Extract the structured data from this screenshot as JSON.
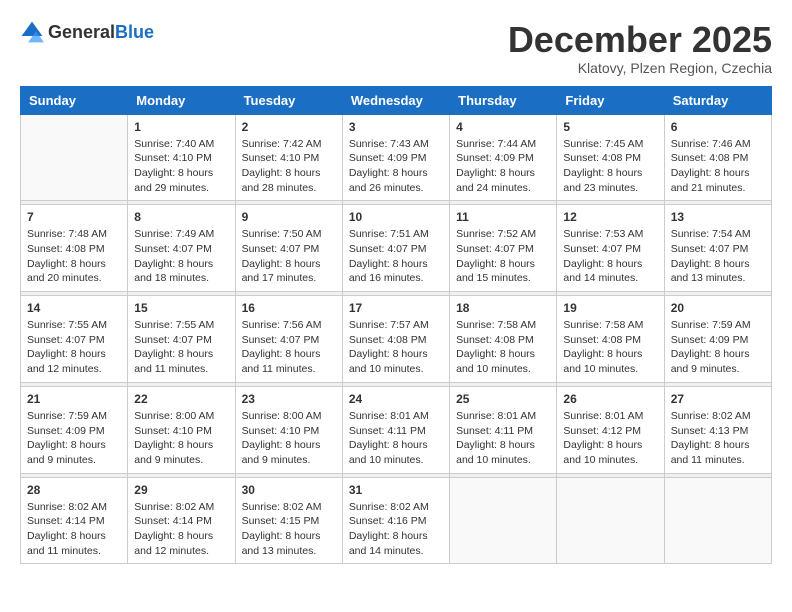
{
  "logo": {
    "general": "General",
    "blue": "Blue"
  },
  "title": "December 2025",
  "location": "Klatovy, Plzen Region, Czechia",
  "headers": [
    "Sunday",
    "Monday",
    "Tuesday",
    "Wednesday",
    "Thursday",
    "Friday",
    "Saturday"
  ],
  "weeks": [
    [
      {
        "day": "",
        "info": ""
      },
      {
        "day": "1",
        "info": "Sunrise: 7:40 AM\nSunset: 4:10 PM\nDaylight: 8 hours\nand 29 minutes."
      },
      {
        "day": "2",
        "info": "Sunrise: 7:42 AM\nSunset: 4:10 PM\nDaylight: 8 hours\nand 28 minutes."
      },
      {
        "day": "3",
        "info": "Sunrise: 7:43 AM\nSunset: 4:09 PM\nDaylight: 8 hours\nand 26 minutes."
      },
      {
        "day": "4",
        "info": "Sunrise: 7:44 AM\nSunset: 4:09 PM\nDaylight: 8 hours\nand 24 minutes."
      },
      {
        "day": "5",
        "info": "Sunrise: 7:45 AM\nSunset: 4:08 PM\nDaylight: 8 hours\nand 23 minutes."
      },
      {
        "day": "6",
        "info": "Sunrise: 7:46 AM\nSunset: 4:08 PM\nDaylight: 8 hours\nand 21 minutes."
      }
    ],
    [
      {
        "day": "7",
        "info": "Sunrise: 7:48 AM\nSunset: 4:08 PM\nDaylight: 8 hours\nand 20 minutes."
      },
      {
        "day": "8",
        "info": "Sunrise: 7:49 AM\nSunset: 4:07 PM\nDaylight: 8 hours\nand 18 minutes."
      },
      {
        "day": "9",
        "info": "Sunrise: 7:50 AM\nSunset: 4:07 PM\nDaylight: 8 hours\nand 17 minutes."
      },
      {
        "day": "10",
        "info": "Sunrise: 7:51 AM\nSunset: 4:07 PM\nDaylight: 8 hours\nand 16 minutes."
      },
      {
        "day": "11",
        "info": "Sunrise: 7:52 AM\nSunset: 4:07 PM\nDaylight: 8 hours\nand 15 minutes."
      },
      {
        "day": "12",
        "info": "Sunrise: 7:53 AM\nSunset: 4:07 PM\nDaylight: 8 hours\nand 14 minutes."
      },
      {
        "day": "13",
        "info": "Sunrise: 7:54 AM\nSunset: 4:07 PM\nDaylight: 8 hours\nand 13 minutes."
      }
    ],
    [
      {
        "day": "14",
        "info": "Sunrise: 7:55 AM\nSunset: 4:07 PM\nDaylight: 8 hours\nand 12 minutes."
      },
      {
        "day": "15",
        "info": "Sunrise: 7:55 AM\nSunset: 4:07 PM\nDaylight: 8 hours\nand 11 minutes."
      },
      {
        "day": "16",
        "info": "Sunrise: 7:56 AM\nSunset: 4:07 PM\nDaylight: 8 hours\nand 11 minutes."
      },
      {
        "day": "17",
        "info": "Sunrise: 7:57 AM\nSunset: 4:08 PM\nDaylight: 8 hours\nand 10 minutes."
      },
      {
        "day": "18",
        "info": "Sunrise: 7:58 AM\nSunset: 4:08 PM\nDaylight: 8 hours\nand 10 minutes."
      },
      {
        "day": "19",
        "info": "Sunrise: 7:58 AM\nSunset: 4:08 PM\nDaylight: 8 hours\nand 10 minutes."
      },
      {
        "day": "20",
        "info": "Sunrise: 7:59 AM\nSunset: 4:09 PM\nDaylight: 8 hours\nand 9 minutes."
      }
    ],
    [
      {
        "day": "21",
        "info": "Sunrise: 7:59 AM\nSunset: 4:09 PM\nDaylight: 8 hours\nand 9 minutes."
      },
      {
        "day": "22",
        "info": "Sunrise: 8:00 AM\nSunset: 4:10 PM\nDaylight: 8 hours\nand 9 minutes."
      },
      {
        "day": "23",
        "info": "Sunrise: 8:00 AM\nSunset: 4:10 PM\nDaylight: 8 hours\nand 9 minutes."
      },
      {
        "day": "24",
        "info": "Sunrise: 8:01 AM\nSunset: 4:11 PM\nDaylight: 8 hours\nand 10 minutes."
      },
      {
        "day": "25",
        "info": "Sunrise: 8:01 AM\nSunset: 4:11 PM\nDaylight: 8 hours\nand 10 minutes."
      },
      {
        "day": "26",
        "info": "Sunrise: 8:01 AM\nSunset: 4:12 PM\nDaylight: 8 hours\nand 10 minutes."
      },
      {
        "day": "27",
        "info": "Sunrise: 8:02 AM\nSunset: 4:13 PM\nDaylight: 8 hours\nand 11 minutes."
      }
    ],
    [
      {
        "day": "28",
        "info": "Sunrise: 8:02 AM\nSunset: 4:14 PM\nDaylight: 8 hours\nand 11 minutes."
      },
      {
        "day": "29",
        "info": "Sunrise: 8:02 AM\nSunset: 4:14 PM\nDaylight: 8 hours\nand 12 minutes."
      },
      {
        "day": "30",
        "info": "Sunrise: 8:02 AM\nSunset: 4:15 PM\nDaylight: 8 hours\nand 13 minutes."
      },
      {
        "day": "31",
        "info": "Sunrise: 8:02 AM\nSunset: 4:16 PM\nDaylight: 8 hours\nand 14 minutes."
      },
      {
        "day": "",
        "info": ""
      },
      {
        "day": "",
        "info": ""
      },
      {
        "day": "",
        "info": ""
      }
    ]
  ]
}
